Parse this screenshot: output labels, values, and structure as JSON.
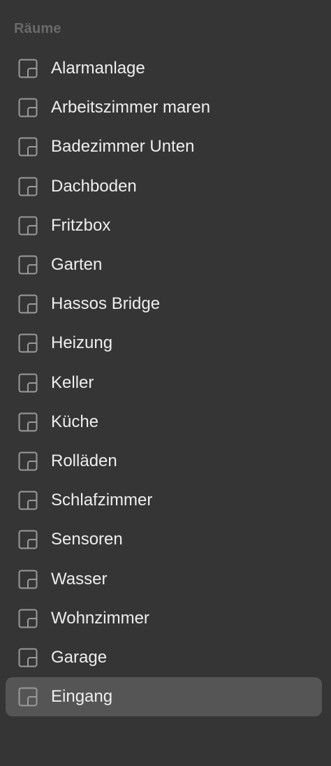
{
  "sidebar": {
    "section_title": "Räume",
    "selected_index": 16,
    "items": [
      {
        "label": "Alarmanlage",
        "icon": "room-icon"
      },
      {
        "label": "Arbeitszimmer maren",
        "icon": "room-icon"
      },
      {
        "label": "Badezimmer Unten",
        "icon": "room-icon"
      },
      {
        "label": "Dachboden",
        "icon": "room-icon"
      },
      {
        "label": "Fritzbox",
        "icon": "room-icon"
      },
      {
        "label": "Garten",
        "icon": "room-icon"
      },
      {
        "label": "Hassos Bridge",
        "icon": "room-icon"
      },
      {
        "label": "Heizung",
        "icon": "room-icon"
      },
      {
        "label": "Keller",
        "icon": "room-icon"
      },
      {
        "label": "Küche",
        "icon": "room-icon"
      },
      {
        "label": "Rolläden",
        "icon": "room-icon"
      },
      {
        "label": "Schlafzimmer",
        "icon": "room-icon"
      },
      {
        "label": "Sensoren",
        "icon": "room-icon"
      },
      {
        "label": "Wasser",
        "icon": "room-icon"
      },
      {
        "label": "Wohnzimmer",
        "icon": "room-icon"
      },
      {
        "label": "Garage",
        "icon": "room-icon"
      },
      {
        "label": "Eingang",
        "icon": "room-icon"
      }
    ]
  },
  "colors": {
    "background": "#353535",
    "selected_row": "#555555",
    "text": "#eeeeee",
    "section_header": "#6a6a6a",
    "icon_stroke": "#9a9a9a"
  }
}
